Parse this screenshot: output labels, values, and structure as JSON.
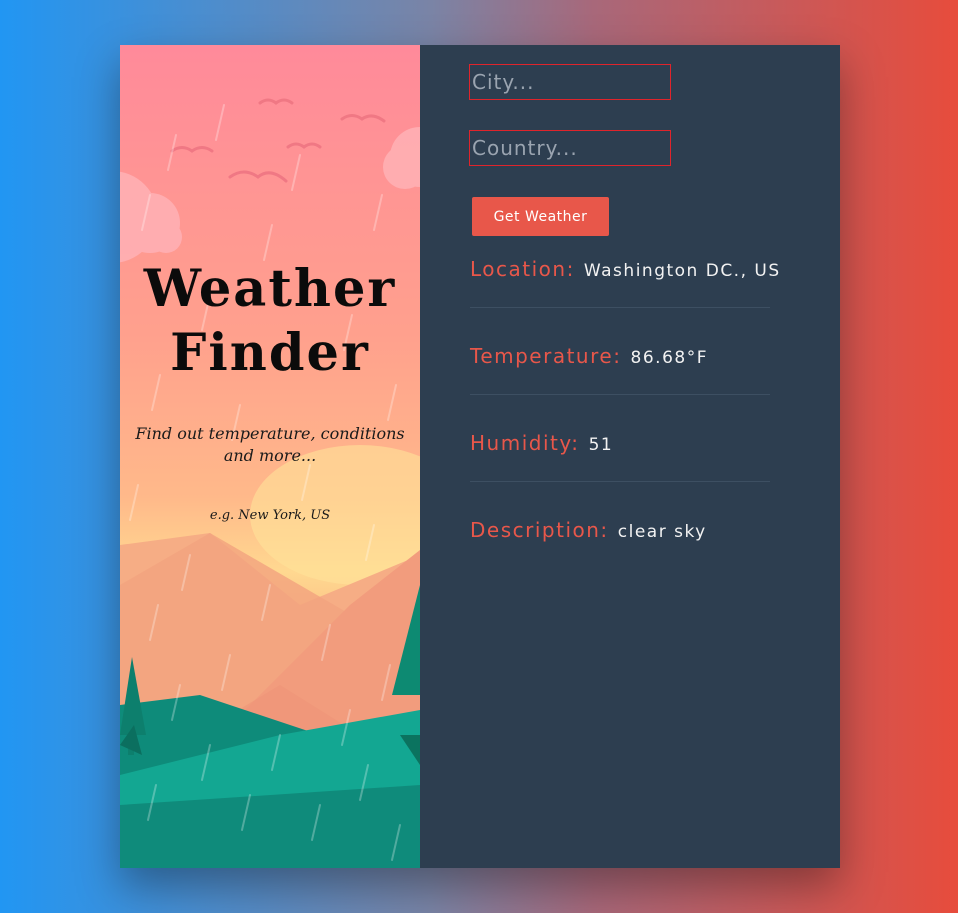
{
  "header": {
    "title_line1": "Weather",
    "title_line2": "Finder",
    "subtitle": "Find out temperature, conditions and more...",
    "example": "e.g. New York, US"
  },
  "form": {
    "city_placeholder": "City...",
    "country_placeholder": "Country...",
    "submit_label": "Get Weather"
  },
  "results": {
    "location_label": "Location:",
    "location_value": "Washington DC., US",
    "temperature_label": "Temperature:",
    "temperature_value": "86.68°F",
    "humidity_label": "Humidity:",
    "humidity_value": "51",
    "description_label": "Description:",
    "description_value": "clear sky"
  },
  "colors": {
    "panel": "#2d3e50",
    "accent": "#e8574a",
    "field_border": "#e0242b"
  }
}
